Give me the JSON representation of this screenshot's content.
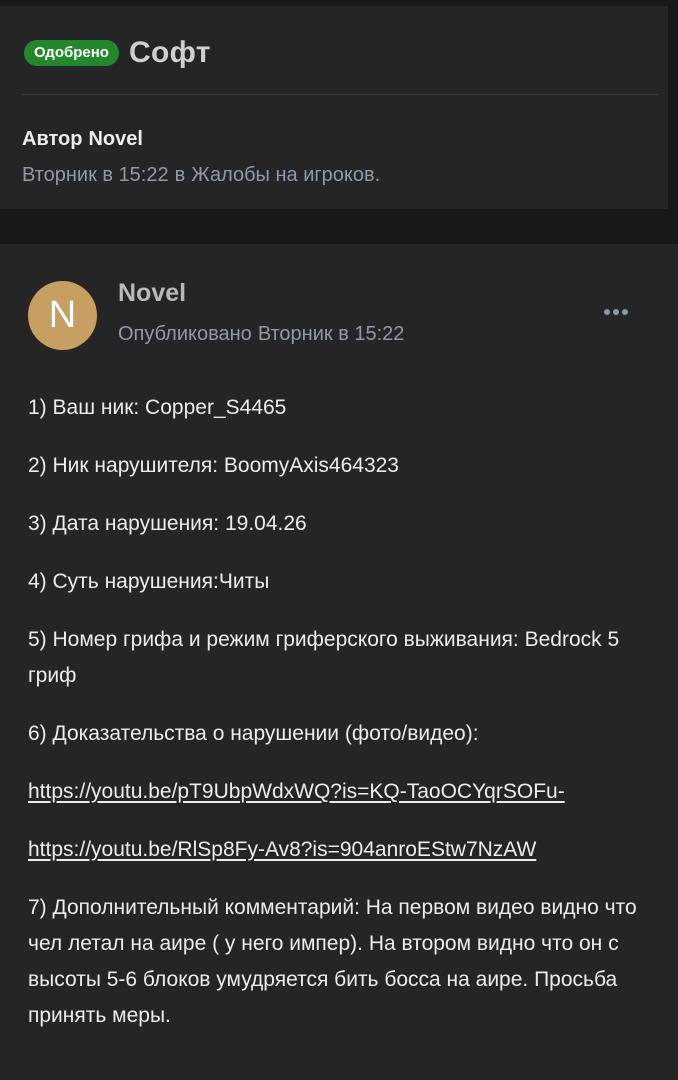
{
  "thread": {
    "status_badge": "Одобрено",
    "title": "Софт",
    "author_prefix": "Автор",
    "author_name": "Novel",
    "date": "Вторник в 15:22",
    "forum_prefix": "в",
    "forum_name": "Жалобы на игроков."
  },
  "post": {
    "avatar_letter": "N",
    "avatar_color": "#c7a061",
    "author": "Novel",
    "published_label": "Опубликовано",
    "date": "Вторник в 15:22",
    "more_icon": "more-horizontal-icon",
    "lines": {
      "nick": "1) Ваш ник: Copper_S4465",
      "violator": "2) Ник нарушителя: BoomyAxis464323",
      "date": "3) Дата нарушения: 19.04.26",
      "essence": "4) Суть нарушения:Читы",
      "grief": "5) Номер грифа и режим гриферского выживания: Bedrock 5 гриф",
      "evidence": "6) Доказательства о нарушении (фото/видео):",
      "link1": "https://youtu.be/pT9UbpWdxWQ?is=KQ-TaoOCYqrSOFu-",
      "link2": "https://youtu.be/RlSp8Fy-Av8?is=904anroEStw7NzAW",
      "comment": "7) Дополнительный комментарий: На первом видео видно что чел летал на аире ( у него импер). На втором видно что он с высоты 5-6 блоков умудряется бить босса на аире. Просьба принять меры."
    }
  },
  "colors": {
    "badge_green": "#23872c",
    "meta_gray": "#8f9aa8",
    "page_bg": "#181818",
    "panel_bg": "#252525"
  }
}
